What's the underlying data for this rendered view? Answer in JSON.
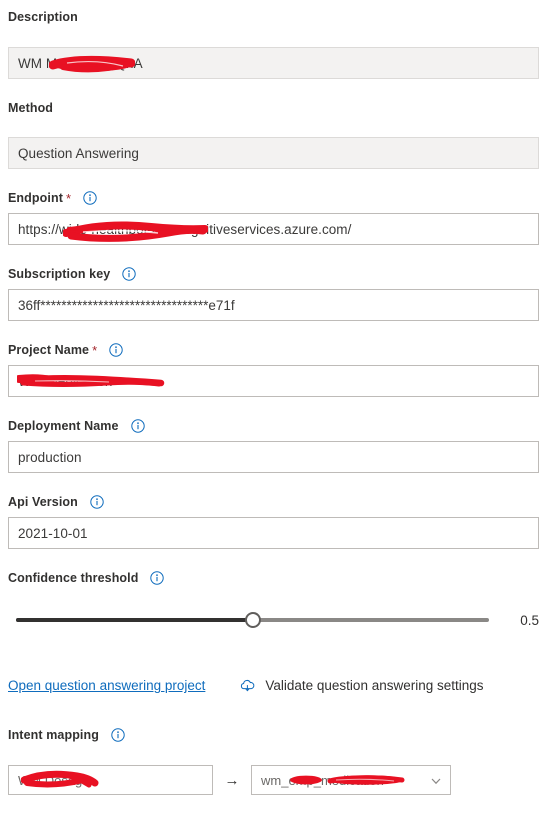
{
  "form": {
    "description": {
      "label": "Description",
      "value": "WM Medication QnA",
      "readonly": true,
      "redacted": true
    },
    "method": {
      "label": "Method",
      "value": "Question Answering",
      "readonly": true,
      "redacted": false
    },
    "endpoint": {
      "label": "Endpoint",
      "required": true,
      "required_marker": "*",
      "info_icon": "info-icon",
      "value": "https://wide-healthbot-dev.cognitiveservices.azure.com/",
      "redacted": true
    },
    "subscription_key": {
      "label": "Subscription key",
      "info_icon": "info-icon",
      "value": "36ff********************************e71f",
      "redacted": false
    },
    "project_name": {
      "label": "Project Name",
      "required": true,
      "required_marker": "*",
      "info_icon": "info-icon",
      "value": "WM-Medication",
      "redacted": true
    },
    "deployment_name": {
      "label": "Deployment Name",
      "info_icon": "info-icon",
      "value": "production",
      "redacted": false
    },
    "api_version": {
      "label": "Api Version",
      "info_icon": "info-icon",
      "value": "2021-10-01",
      "redacted": false
    },
    "confidence_threshold": {
      "label": "Confidence threshold",
      "info_icon": "info-icon",
      "value": "0.5",
      "percent": 50,
      "min": 0,
      "max": 1
    },
    "actions": {
      "open_project_link": "Open question answering project",
      "validate_icon": "cloud-sync-icon",
      "validate_label": "Validate question answering settings"
    },
    "intent_mapping": {
      "label": "Intent mapping",
      "info_icon": "info-icon",
      "arrow": "→",
      "source_value": "WM Dosage",
      "target_value": "wm_emp_medication",
      "target_chevron": "chevron-down-icon",
      "source_redacted": true,
      "target_redacted": true
    }
  },
  "colors": {
    "link": "#0f6cbd",
    "info": "#0f6cbd",
    "required": "#a4262c",
    "redaction": "#e81123",
    "label": "#323130",
    "field_border": "#bebbb8",
    "readonly_bg": "#f3f2f1",
    "track_active": "#323130",
    "track_inactive": "#8a8886"
  }
}
